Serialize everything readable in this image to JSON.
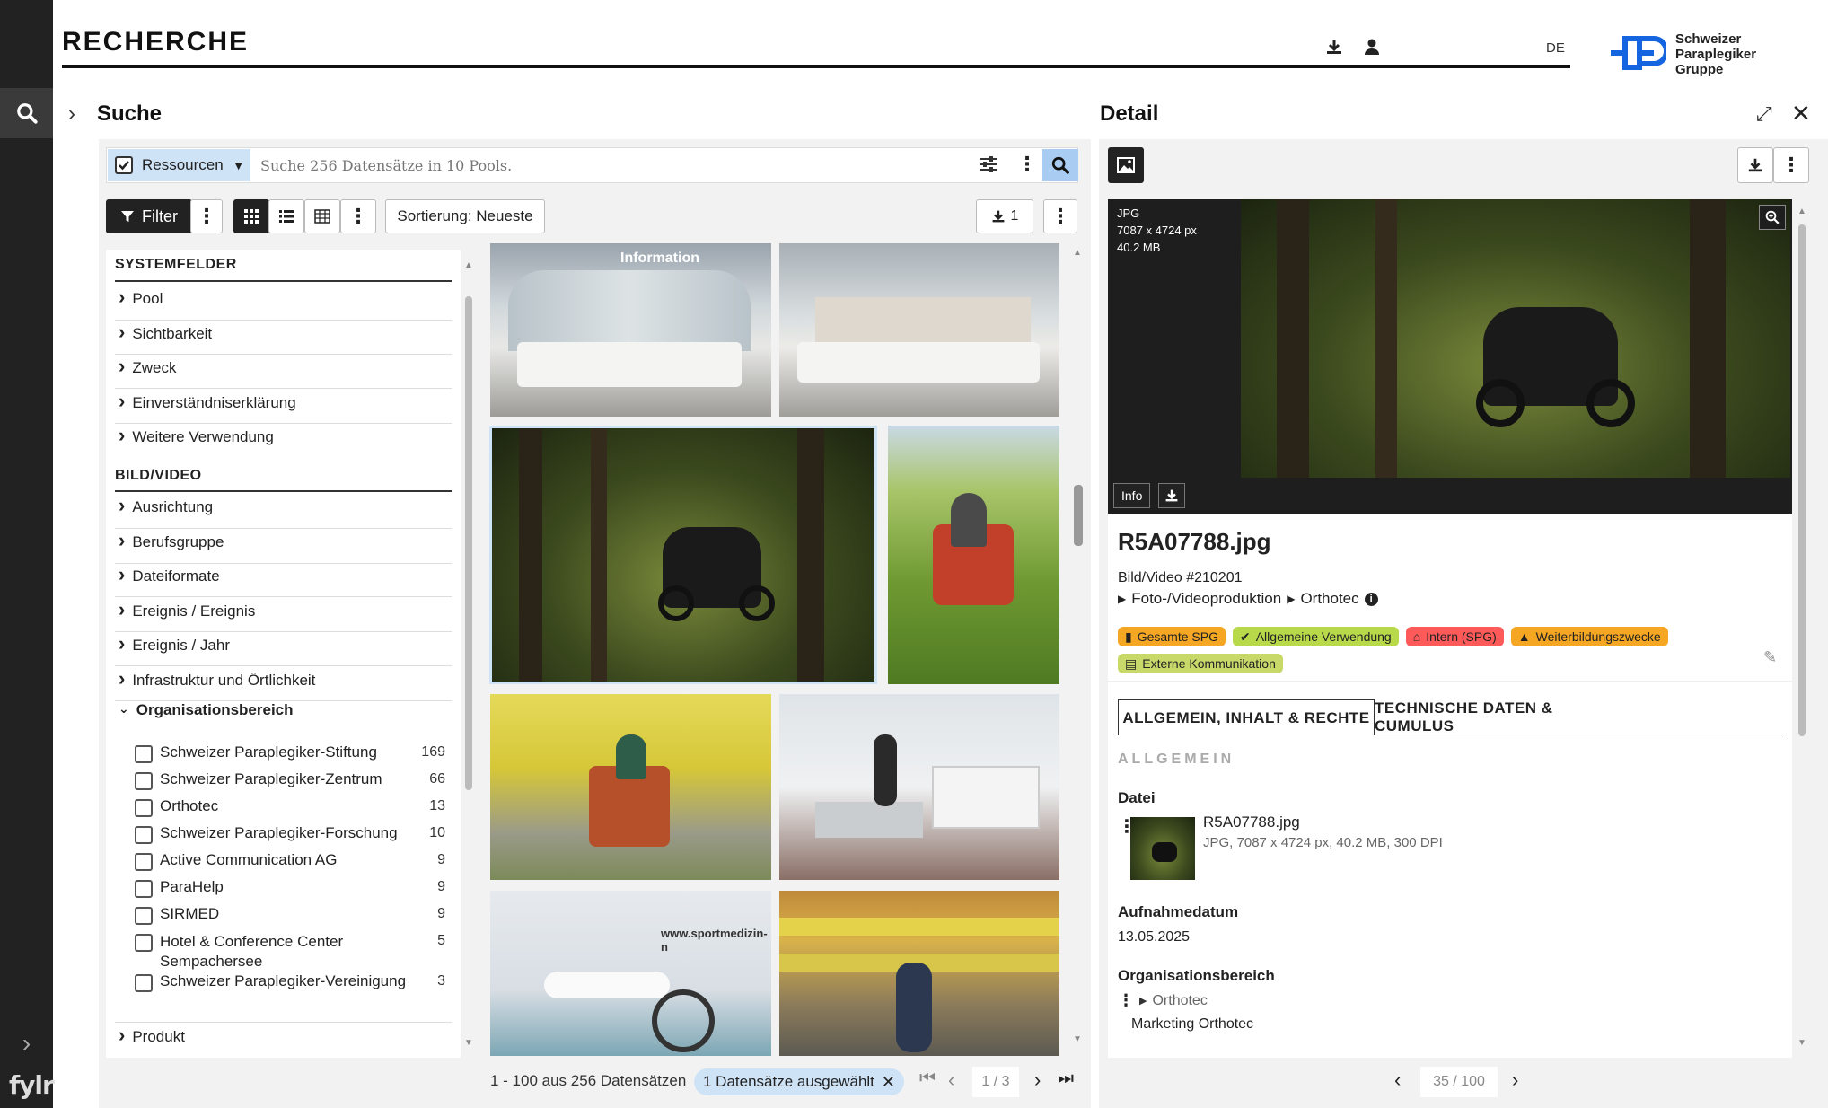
{
  "header": {
    "title": "RECHERCHE",
    "lang": "DE",
    "logo_lines": [
      "Schweizer",
      "Paraplegiker",
      "Gruppe"
    ]
  },
  "rail": {
    "brand": "fylr"
  },
  "search": {
    "title": "Suche",
    "scope_label": "Ressourcen",
    "placeholder": "Suche 256 Datensätze in 10 Pools.",
    "filter_label": "Filter",
    "sort_label": "Sortierung: Neueste",
    "download_count": "1"
  },
  "filters": {
    "system_header": "SYSTEMFELDER",
    "system_items": [
      "Pool",
      "Sichtbarkeit",
      "Zweck",
      "Einverständniserklärung",
      "Weitere Verwendung"
    ],
    "media_header": "BILD/VIDEO",
    "media_items": [
      "Ausrichtung",
      "Berufsgruppe",
      "Dateiformate",
      "Ereignis / Ereignis",
      "Ereignis / Jahr",
      "Infrastruktur und Örtlichkeit"
    ],
    "org_header": "Organisationsbereich",
    "org_options": [
      {
        "label": "Schweizer Paraplegiker-Stiftung",
        "count": "169"
      },
      {
        "label": "Schweizer Paraplegiker-Zentrum",
        "count": "66"
      },
      {
        "label": "Orthotec",
        "count": "13"
      },
      {
        "label": "Schweizer Paraplegiker-Forschung",
        "count": "10"
      },
      {
        "label": "Active Communication AG",
        "count": "9"
      },
      {
        "label": "ParaHelp",
        "count": "9"
      },
      {
        "label": "SIRMED",
        "count": "9"
      },
      {
        "label": "Hotel & Conference Center Sempachersee",
        "count": "5"
      },
      {
        "label": "Schweizer Paraplegiker-Vereinigung",
        "count": "3"
      }
    ],
    "product_label": "Produkt"
  },
  "results": {
    "range": "1 - 100 aus 256 Datensätzen",
    "selected": "1 Datensätze ausgewählt",
    "page": "1 / 3",
    "thumb_sign": "Information",
    "thumb_sign2": "www.sportmedizin-n"
  },
  "detail": {
    "title": "Detail",
    "file_type": "JPG",
    "dims": "7087 x 4724 px",
    "size": "40.2 MB",
    "info_label": "Info",
    "filename": "R5A07788.jpg",
    "record": "Bild/Video #210201",
    "path": [
      "Foto-/Videoproduktion",
      "Orthotec"
    ],
    "tags": [
      {
        "label": "Gesamte SPG",
        "color": "#f5a623"
      },
      {
        "label": "Allgemeine Verwendung",
        "color": "#b8d94a"
      },
      {
        "label": "Intern (SPG)",
        "color": "#ff5a5a"
      },
      {
        "label": "Weiterbildungszwecke",
        "color": "#f5a623"
      },
      {
        "label": "Externe Kommunikation",
        "color": "#c8d96a"
      }
    ],
    "tab1": "ALLGEMEIN, INHALT & RECHTE",
    "tab2": "TECHNISCHE DATEN & CUMULUS",
    "section": "ALLGEMEIN",
    "datei_label": "Datei",
    "datei_name": "R5A07788.jpg",
    "datei_meta": "JPG, 7087 x 4724 px, 40.2 MB, 300 DPI",
    "date_label": "Aufnahmedatum",
    "date_value": "13.05.2025",
    "org_label": "Organisationsbereich",
    "org_value": "Orthotec",
    "org_sub": "Marketing Orthotec",
    "pager": "35 / 100"
  },
  "colors": {
    "accent": "#4a90d9",
    "dark": "#222222",
    "selected_bg": "#cfe3f7"
  }
}
